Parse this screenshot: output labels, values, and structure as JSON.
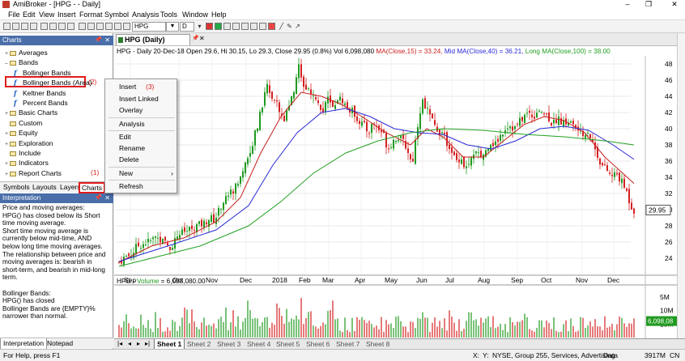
{
  "titlebar": {
    "title": "AmiBroker - [HPG - - Daily]",
    "minimize": "–",
    "restore": "❐",
    "close": "✕"
  },
  "menu": [
    "File",
    "Edit",
    "View",
    "Insert",
    "Format",
    "Symbol",
    "Analysis",
    "Tools",
    "Window",
    "Help"
  ],
  "toolbar": {
    "symbol": "HPG",
    "interval": "D"
  },
  "charts_panel": {
    "title": "Charts",
    "tree": [
      {
        "label": "Averages",
        "type": "folder",
        "exp": "+"
      },
      {
        "label": "Bands",
        "type": "folder",
        "exp": "–"
      },
      {
        "label": "Bollinger Bands",
        "type": "formula"
      },
      {
        "label": "Bollinger Bands (Area)",
        "type": "formula"
      },
      {
        "label": "Keltner Bands",
        "type": "formula"
      },
      {
        "label": "Percent Bands",
        "type": "formula"
      },
      {
        "label": "Basic Charts",
        "type": "folder",
        "exp": "+"
      },
      {
        "label": "Custom",
        "type": "folder",
        "exp": ""
      },
      {
        "label": "Equity",
        "type": "folder",
        "exp": "+"
      },
      {
        "label": "Exploration",
        "type": "folder",
        "exp": "+"
      },
      {
        "label": "Include",
        "type": "folder",
        "exp": ""
      },
      {
        "label": "Indicators",
        "type": "folder",
        "exp": "+"
      },
      {
        "label": "Report Charts",
        "type": "folder",
        "exp": "+"
      }
    ],
    "annot_2": "(2)",
    "tabs": [
      "Symbols",
      "Layouts",
      "Layers",
      "Charts"
    ],
    "annot_1": "(1)"
  },
  "interpretation_panel": {
    "title": "Interpretation",
    "text": "Price and moving averages:\nHPG() has closed below its Short\ntime moving average.\nShort time moving average is\ncurrently below mid-time, AND\nbelow long time moving averages.\nThe relationship between price and\nmoving averages is: bearish in\nshort-term, and bearish in mid-long\nterm.\n\nBollinger Bands:\nHPG() has closed\nBollinger Bands are {EMPTY}%\nnarrower than normal.",
    "tabs": [
      "Interpretation",
      "Notepad"
    ]
  },
  "context_menu": {
    "annot_3": "(3)",
    "items": [
      "Insert",
      "Insert Linked",
      "Overlay",
      "Analysis",
      "Edit",
      "Rename",
      "Delete",
      "New",
      "Refresh"
    ],
    "new_arrow": "›"
  },
  "chart_window": {
    "tab": "HPG (Daily)",
    "price_header": {
      "prefix": "HPG - Daily 20-Dec-18 Open 29.6, Hi 30.15, Lo 29.3, Close 29.95 (0.8%) Vol 6,098,080",
      "ma15": "MA(Close,15) = 33.24,",
      "ma40": "Mid MA(Close,40) = 36.21,",
      "ma100": "Long MA(Close,100) = 38.00"
    },
    "volume_header": {
      "prefix": "HPG -",
      "label": "Volume",
      "value": "= 6,098,080.00"
    },
    "current_price": "29.95",
    "current_volume": "6,098,08"
  },
  "sheets": [
    "Sheet 1",
    "Sheet 2",
    "Sheet 3",
    "Sheet 4",
    "Sheet 5",
    "Sheet 6",
    "Sheet 7",
    "Sheet 8"
  ],
  "status": {
    "left": "For Help, press F1",
    "x": "X:",
    "y": "Y:",
    "info": "NYSE, Group 255, Services, Advertising",
    "data": "Data",
    "mem": "3917M",
    "cap": "CN"
  },
  "colors": {
    "ma15": "#c8201e",
    "ma40": "#2a2ad8",
    "ma100": "#22a022",
    "up": "#1f9a1f",
    "down": "#d42020",
    "header_blue": "#4a6ea9"
  },
  "chart_data": [
    {
      "type": "candlestick",
      "title": "HPG - Daily",
      "x_tick_labels": [
        "Sep",
        "Oct",
        "Nov",
        "Dec",
        "2018",
        "Feb",
        "Mar",
        "Apr",
        "May",
        "Jun",
        "Jul",
        "Aug",
        "Sep",
        "Oct",
        "Nov",
        "Dec"
      ],
      "y_tick_labels": [
        24,
        26,
        28,
        30,
        32,
        34,
        36,
        38,
        40,
        42,
        44,
        46,
        48
      ],
      "ylim": [
        22,
        49
      ],
      "close_path": [
        [
          0,
          23.5
        ],
        [
          8,
          24.2
        ],
        [
          16,
          24.5
        ],
        [
          22,
          25.5
        ],
        [
          30,
          25.8
        ],
        [
          40,
          26.2
        ],
        [
          46,
          26.7
        ],
        [
          55,
          26.0
        ],
        [
          64,
          25.3
        ],
        [
          73,
          27.0
        ],
        [
          82,
          27.3
        ],
        [
          88,
          27.6
        ],
        [
          95,
          28.0
        ],
        [
          105,
          28.3
        ],
        [
          112,
          29.0
        ],
        [
          118,
          28.7
        ],
        [
          126,
          30.5
        ],
        [
          134,
          31.8
        ],
        [
          142,
          32.5
        ],
        [
          150,
          34.0
        ],
        [
          158,
          36.5
        ],
        [
          164,
          38.0
        ],
        [
          170,
          40.0
        ],
        [
          176,
          42.5
        ],
        [
          182,
          45.5
        ],
        [
          190,
          43.5
        ],
        [
          196,
          43.0
        ],
        [
          202,
          41.0
        ],
        [
          208,
          42.0
        ],
        [
          214,
          44.0
        ],
        [
          218,
          46.0
        ],
        [
          222,
          47.5
        ],
        [
          228,
          45.5
        ],
        [
          234,
          44.5
        ],
        [
          240,
          44.0
        ],
        [
          246,
          43.5
        ],
        [
          252,
          42.0
        ],
        [
          258,
          43.8
        ],
        [
          264,
          42.5
        ],
        [
          270,
          43.8
        ],
        [
          276,
          43.5
        ],
        [
          282,
          42.5
        ],
        [
          290,
          42.0
        ],
        [
          296,
          41.0
        ],
        [
          302,
          40.5
        ],
        [
          308,
          39.5
        ],
        [
          314,
          40.8
        ],
        [
          320,
          40.0
        ],
        [
          326,
          39.5
        ],
        [
          332,
          37.5
        ],
        [
          338,
          38.5
        ],
        [
          344,
          39.0
        ],
        [
          350,
          38.5
        ],
        [
          356,
          37.5
        ],
        [
          362,
          35.5
        ],
        [
          368,
          40.0
        ],
        [
          374,
          43.5
        ],
        [
          380,
          42.5
        ],
        [
          386,
          41.0
        ],
        [
          392,
          40.0
        ],
        [
          398,
          39.5
        ],
        [
          404,
          38.5
        ],
        [
          410,
          37.5
        ],
        [
          416,
          36.0
        ],
        [
          422,
          36.5
        ],
        [
          428,
          35.0
        ],
        [
          434,
          36.0
        ],
        [
          440,
          37.0
        ],
        [
          446,
          36.5
        ],
        [
          452,
          37.0
        ],
        [
          458,
          38.5
        ],
        [
          464,
          38.0
        ],
        [
          470,
          39.0
        ],
        [
          476,
          40.0
        ],
        [
          482,
          40.5
        ],
        [
          488,
          40.0
        ],
        [
          494,
          40.8
        ],
        [
          500,
          41.5
        ],
        [
          506,
          42.0
        ],
        [
          512,
          41.5
        ],
        [
          518,
          42.5
        ],
        [
          524,
          42.0
        ],
        [
          530,
          41.5
        ],
        [
          536,
          40.5
        ],
        [
          542,
          41.5
        ],
        [
          548,
          40.5
        ],
        [
          554,
          41.0
        ],
        [
          560,
          40.5
        ],
        [
          566,
          40.0
        ],
        [
          572,
          39.0
        ],
        [
          578,
          40.0
        ],
        [
          584,
          38.5
        ],
        [
          590,
          37.0
        ],
        [
          596,
          35.5
        ],
        [
          602,
          35.0
        ],
        [
          608,
          34.0
        ],
        [
          614,
          34.5
        ],
        [
          620,
          33.5
        ],
        [
          626,
          32.5
        ],
        [
          632,
          30.5
        ],
        [
          636,
          29.95
        ]
      ],
      "series": [
        {
          "name": "MA(Close,15)",
          "values": [
            [
              0,
              23.5
            ],
            [
              40,
              25.5
            ],
            [
              80,
              26.5
            ],
            [
              120,
              28.5
            ],
            [
              150,
              31.5
            ],
            [
              175,
              37.0
            ],
            [
              200,
              41.5
            ],
            [
              225,
              44.5
            ],
            [
              250,
              44.0
            ],
            [
              275,
              43.0
            ],
            [
              300,
              41.5
            ],
            [
              330,
              39.5
            ],
            [
              360,
              38.0
            ],
            [
              380,
              40.0
            ],
            [
              400,
              39.0
            ],
            [
              425,
              36.5
            ],
            [
              450,
              36.5
            ],
            [
              475,
              38.5
            ],
            [
              500,
              40.5
            ],
            [
              525,
              41.5
            ],
            [
              550,
              41.0
            ],
            [
              575,
              39.5
            ],
            [
              600,
              36.5
            ],
            [
              636,
              33.24
            ]
          ]
        },
        {
          "name": "Mid MA(Close,40)",
          "values": [
            [
              0,
              23.6
            ],
            [
              60,
              25.5
            ],
            [
              120,
              27.5
            ],
            [
              160,
              30.5
            ],
            [
              190,
              35.5
            ],
            [
              220,
              39.5
            ],
            [
              250,
              42.0
            ],
            [
              280,
              42.5
            ],
            [
              310,
              41.5
            ],
            [
              340,
              40.0
            ],
            [
              370,
              39.5
            ],
            [
              400,
              39.3
            ],
            [
              430,
              38.0
            ],
            [
              460,
              37.5
            ],
            [
              490,
              38.5
            ],
            [
              520,
              40.0
            ],
            [
              550,
              40.3
            ],
            [
              580,
              39.8
            ],
            [
              610,
              38.0
            ],
            [
              636,
              36.21
            ]
          ]
        },
        {
          "name": "Long MA(Close,100)",
          "values": [
            [
              0,
              23.0
            ],
            [
              100,
              25.5
            ],
            [
              160,
              28.0
            ],
            [
              200,
              31.0
            ],
            [
              240,
              34.5
            ],
            [
              280,
              37.0
            ],
            [
              320,
              38.5
            ],
            [
              360,
              39.5
            ],
            [
              400,
              40.0
            ],
            [
              450,
              39.8
            ],
            [
              500,
              39.3
            ],
            [
              550,
              39.0
            ],
            [
              600,
              38.5
            ],
            [
              636,
              38.0
            ]
          ]
        }
      ],
      "last_close": 29.95
    },
    {
      "type": "bar",
      "title": "HPG - Volume",
      "y_tick_labels": [
        "5M",
        "10M",
        "15M"
      ],
      "last_value": 6098080
    }
  ]
}
